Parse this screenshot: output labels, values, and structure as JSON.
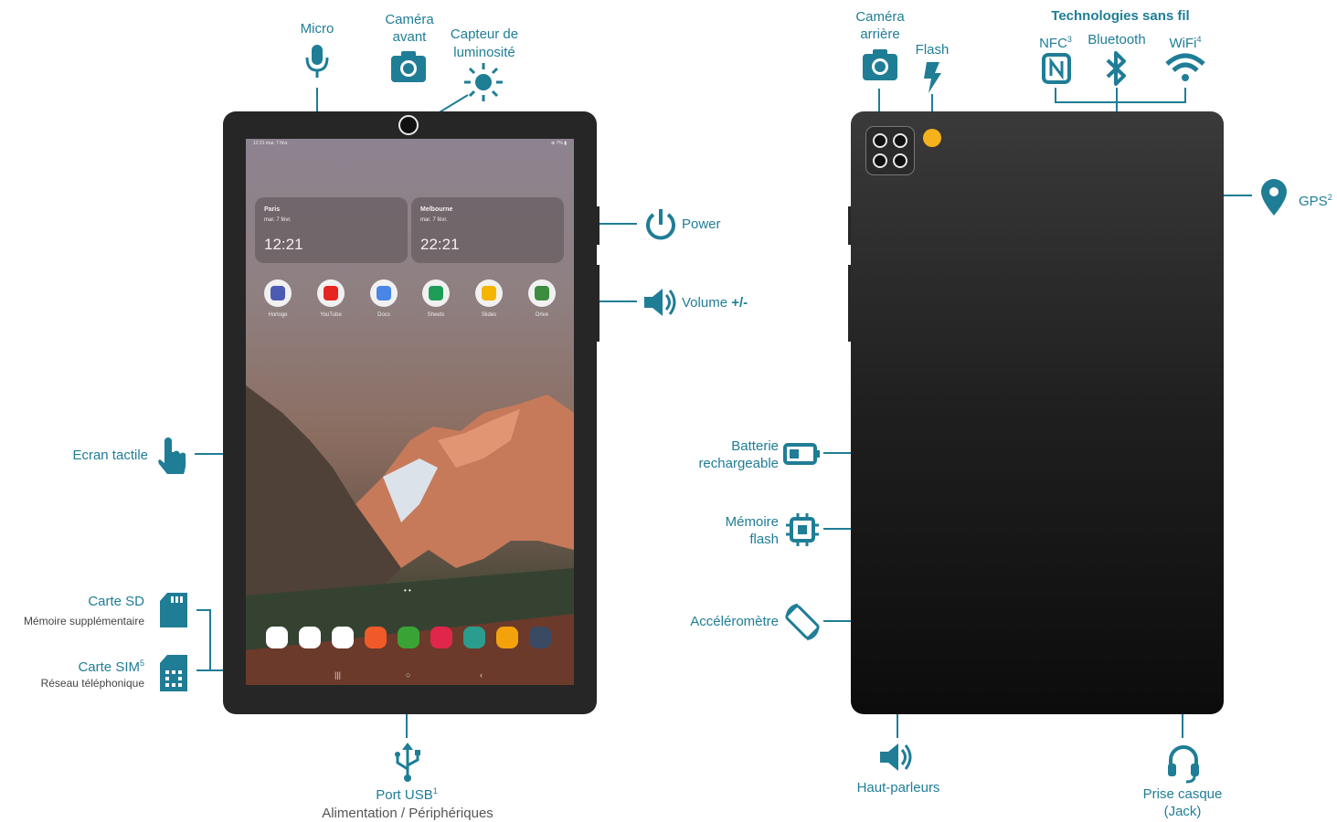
{
  "colors": {
    "accent": "#1f7d96",
    "device": "#262626",
    "flash_dot": "#f6b21a"
  },
  "front": {
    "micro": "Micro",
    "camera_front_1": "Caméra",
    "camera_front_2": "avant",
    "light_sensor_1": "Capteur de",
    "light_sensor_2": "luminosité",
    "power": "Power",
    "volume_prefix": "Volume ",
    "volume_suffix": "+/-",
    "touchscreen": "Ecran tactile",
    "sd_card": "Carte SD",
    "sd_card_sub": "Mémoire supplémentaire",
    "sim_card": "Carte SIM",
    "sim_card_sup": "5",
    "sim_card_sub": "Réseau téléphonique",
    "usb_port": "Port USB",
    "usb_port_sup": "1",
    "usb_port_sub": "Alimentation / Périphériques"
  },
  "screen": {
    "status_time": "12:21  mar. 7 févr.",
    "status_right": "⊕ 7% ▮",
    "widgets": [
      {
        "city": "Paris",
        "date": "mar. 7 févr.",
        "time": "12:21"
      },
      {
        "city": "Melbourne",
        "date": "mar. 7 févr.",
        "time": "22:21"
      }
    ],
    "apps": [
      {
        "name": "Horloge",
        "icon": "clock-icon",
        "color": "#4c5bb3"
      },
      {
        "name": "YouTube",
        "icon": "youtube-icon",
        "color": "#e52521"
      },
      {
        "name": "Docs",
        "icon": "docs-icon",
        "color": "#4a86e8"
      },
      {
        "name": "Sheets",
        "icon": "sheets-icon",
        "color": "#1e9d58"
      },
      {
        "name": "Slides",
        "icon": "slides-icon",
        "color": "#f4b400"
      },
      {
        "name": "Drive",
        "icon": "drive-icon",
        "color": "#3c8d40"
      }
    ],
    "dock": [
      {
        "icon": "chrome-icon",
        "color": "#ffffff"
      },
      {
        "icon": "maps-icon",
        "color": "#ffffff"
      },
      {
        "icon": "gmail-icon",
        "color": "#ffffff"
      },
      {
        "icon": "notes-icon",
        "color": "#f05a28"
      },
      {
        "icon": "calculator-icon",
        "color": "#3aa335"
      },
      {
        "icon": "camera-app-icon",
        "color": "#e0264a"
      },
      {
        "icon": "calendar-icon",
        "color": "#2a9d8f"
      },
      {
        "icon": "files-icon",
        "color": "#f4a20b"
      },
      {
        "icon": "app-drawer-icon",
        "color": "#3b4a63"
      }
    ]
  },
  "back": {
    "camera_rear_1": "Caméra",
    "camera_rear_2": "arrière",
    "flash": "Flash",
    "wireless_title": "Technologies sans fil",
    "nfc": "NFC",
    "nfc_sup": "3",
    "bluetooth": "Bluetooth",
    "wifi": "WiFi",
    "wifi_sup": "4",
    "gps": "GPS",
    "gps_sup": "2",
    "battery_1": "Batterie",
    "battery_2": "rechargeable",
    "memory_1": "Mémoire",
    "memory_2": "flash",
    "accelerometer": "Accéléromètre",
    "speakers": "Haut-parleurs",
    "jack_1": "Prise casque",
    "jack_2": "(Jack)"
  }
}
